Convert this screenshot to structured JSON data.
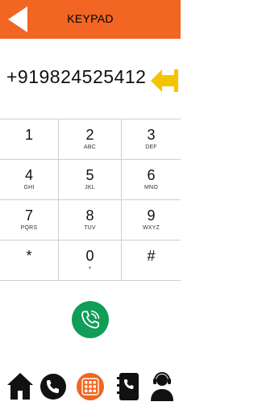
{
  "header": {
    "title": "KEYPAD",
    "back_icon": "back-triangle-icon",
    "color": "#f26522"
  },
  "dialer": {
    "number": "+919824525412",
    "backspace_icon": "backspace-arrow-icon",
    "accent": "#f5c400"
  },
  "keypad": {
    "keys": [
      {
        "digit": "1",
        "letters": ""
      },
      {
        "digit": "2",
        "letters": "ABC"
      },
      {
        "digit": "3",
        "letters": "DEF"
      },
      {
        "digit": "4",
        "letters": "GHI"
      },
      {
        "digit": "5",
        "letters": "JKL"
      },
      {
        "digit": "6",
        "letters": "MNO"
      },
      {
        "digit": "7",
        "letters": "PQRS"
      },
      {
        "digit": "8",
        "letters": "TUV"
      },
      {
        "digit": "9",
        "letters": "WXYZ"
      },
      {
        "digit": "*",
        "letters": ""
      },
      {
        "digit": "0",
        "letters": "+"
      },
      {
        "digit": "#",
        "letters": ""
      }
    ]
  },
  "call_button": {
    "icon": "phone-call-icon",
    "color": "#0f9d58"
  },
  "bottom_nav": {
    "items": [
      {
        "icon": "home-icon"
      },
      {
        "icon": "call-history-icon"
      },
      {
        "icon": "keypad-grid-icon",
        "active": true
      },
      {
        "icon": "contacts-book-icon"
      },
      {
        "icon": "support-agent-icon"
      }
    ]
  }
}
